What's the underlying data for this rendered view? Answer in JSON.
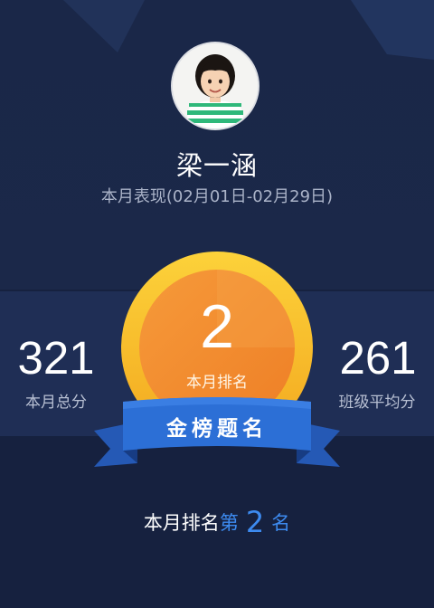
{
  "profile": {
    "name": "梁一涵",
    "period": "本月表现(02月01日-02月29日)"
  },
  "stats": {
    "total_score": "321",
    "total_score_label": "本月总分",
    "class_average": "261",
    "class_average_label": "班级平均分"
  },
  "medal": {
    "rank": "2",
    "rank_label": "本月排名",
    "banner_text": "金榜题名"
  },
  "footer": {
    "prefix": "本月排名",
    "di": "第",
    "rank": "2",
    "suffix": "名"
  },
  "colors": {
    "background": "#16213f",
    "band": "#1f2e55",
    "medal_outer": "#f7b927",
    "medal_inner": "#f28a2e",
    "ribbon": "#2c6fd6",
    "highlight": "#3d8bf0"
  }
}
